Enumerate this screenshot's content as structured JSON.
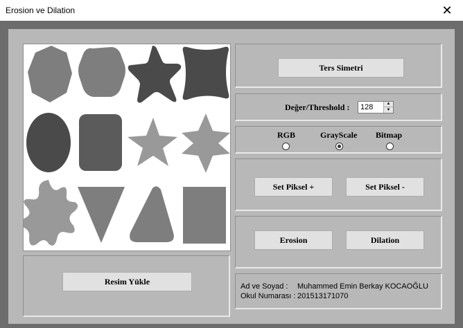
{
  "window": {
    "title": "Erosion ve Dilation",
    "close_glyph": "✕"
  },
  "buttons": {
    "ters_simetri": "Ters Simetri",
    "set_piksel_plus": "Set Piksel +",
    "set_piksel_minus": "Set Piksel -",
    "erosion": "Erosion",
    "dilation": "Dilation",
    "resim_yukle": "Resim Yükle"
  },
  "threshold": {
    "label": "Değer/Threshold :",
    "value": "128"
  },
  "mode": {
    "options": [
      "RGB",
      "GrayScale",
      "Bitmap"
    ],
    "selected": "GrayScale"
  },
  "info": {
    "name_label": "Ad ve Soyad :",
    "name_value": "Muhammed Emin Berkay KOCAOĞLU",
    "number_label": "Okul Numarası :",
    "number_value": "201513171070"
  },
  "image": {
    "content": "grayscale geometric shapes",
    "colors": {
      "light": "#7e7e7e",
      "dark": "#4a4a4a",
      "mid": "#5b5b5b",
      "star": "#999999"
    }
  }
}
